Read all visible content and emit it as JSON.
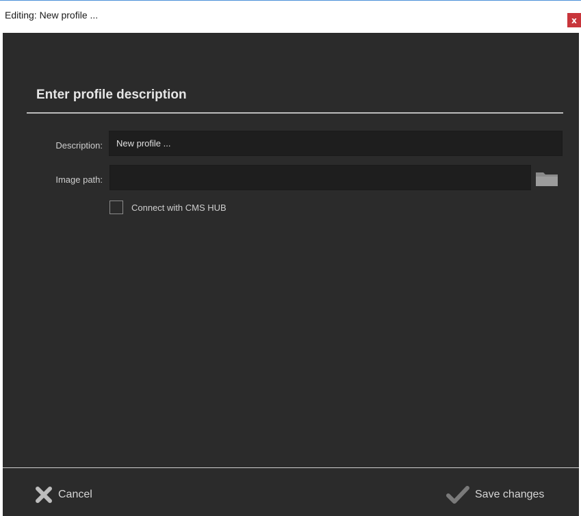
{
  "window": {
    "title": "Editing: New profile ...",
    "close_label": "x",
    "accent_color": "#4a90d9",
    "close_color": "#c8353b"
  },
  "form": {
    "heading": "Enter profile description",
    "description": {
      "label": "Description:",
      "value": "New profile ..."
    },
    "image_path": {
      "label": "Image path:",
      "value": "",
      "browse_icon": "folder-icon"
    },
    "cms_hub": {
      "label": "Connect with CMS HUB",
      "checked": false
    }
  },
  "footer": {
    "cancel_label": "Cancel",
    "cancel_icon": "close-x-icon",
    "save_label": "Save changes",
    "save_icon": "checkmark-icon"
  }
}
